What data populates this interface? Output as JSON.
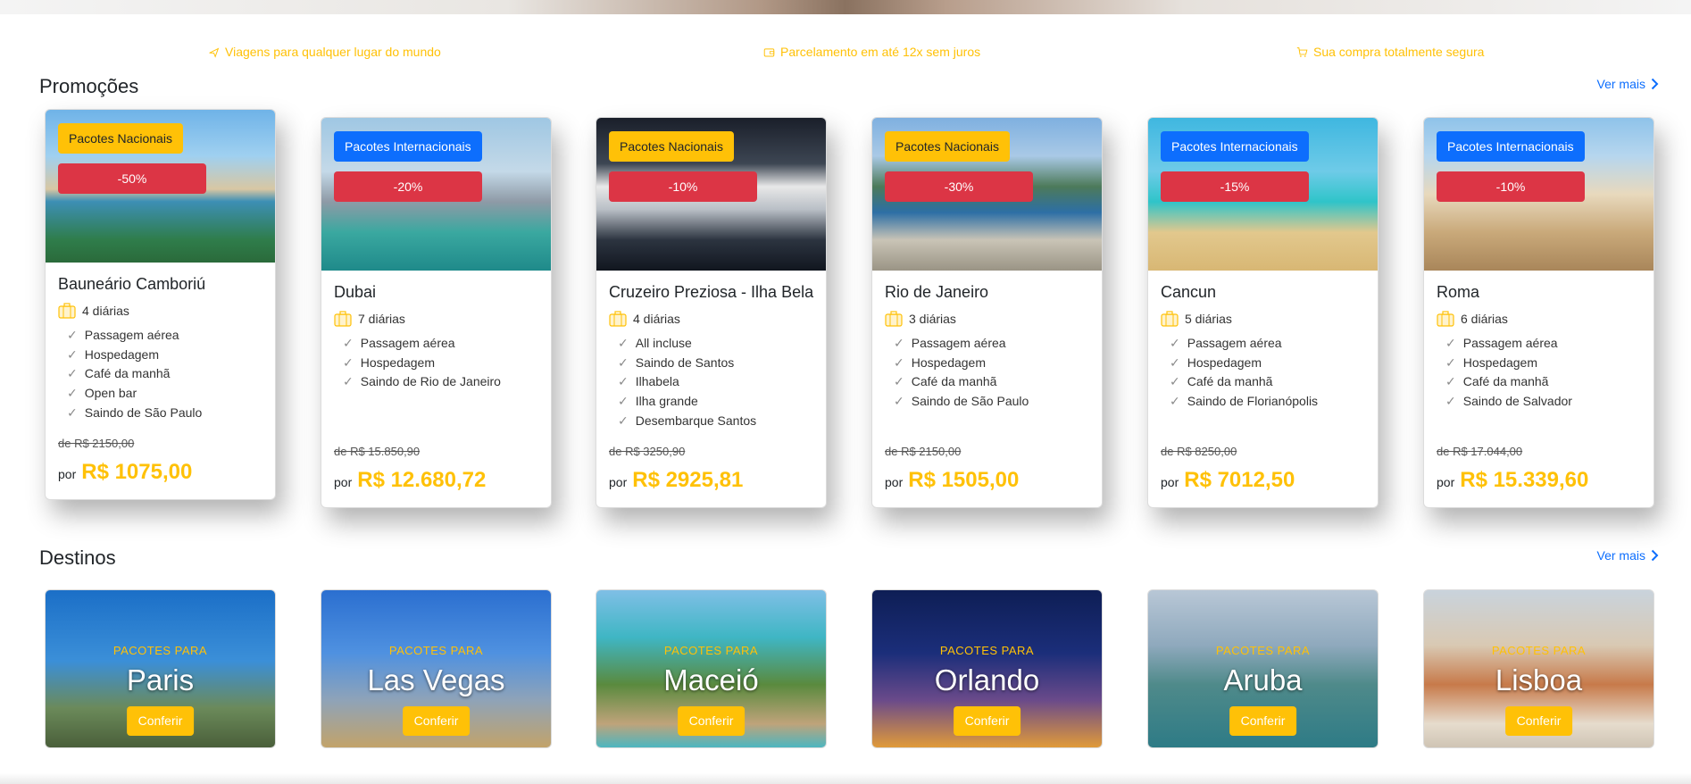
{
  "features": [
    {
      "icon": "plane-icon",
      "text": "Viagens para qualquer lugar do mundo"
    },
    {
      "icon": "wallet-icon",
      "text": "Parcelamento em até 12x sem juros"
    },
    {
      "icon": "secure-cart-icon",
      "text": "Sua compra totalmente segura"
    }
  ],
  "promocoes": {
    "title": "Promoções",
    "ver_mais": "Ver mais",
    "cards": [
      {
        "type": "Pacotes Nacionais",
        "discount": "-50%",
        "name": "Bauneário Camboriú",
        "days": "4 diárias",
        "items": [
          "Passagem aérea",
          "Hospedagem",
          "Café da manhã",
          "Open bar",
          "Saindo de São Paulo"
        ],
        "old_price": "de R$ 2150,00",
        "por": "por",
        "price": "R$ 1075,00"
      },
      {
        "type": "Pacotes Internacionais",
        "discount": "-20%",
        "name": "Dubai",
        "days": "7 diárias",
        "items": [
          "Passagem aérea",
          "Hospedagem",
          "Saindo de Rio de Janeiro"
        ],
        "old_price": "de R$ 15.850,90",
        "por": "por",
        "price": "R$ 12.680,72"
      },
      {
        "type": "Pacotes Nacionais",
        "discount": "-10%",
        "name": "Cruzeiro Preziosa - Ilha Bela",
        "days": "4 diárias",
        "items": [
          "All incluse",
          "Saindo de Santos",
          "Ilhabela",
          "Ilha grande",
          "Desembarque Santos"
        ],
        "old_price": "de R$ 3250,90",
        "por": "por",
        "price": "R$ 2925,81"
      },
      {
        "type": "Pacotes Nacionais",
        "discount": "-30%",
        "name": "Rio de Janeiro",
        "days": "3 diárias",
        "items": [
          "Passagem aérea",
          "Hospedagem",
          "Café da manhã",
          "Saindo de São Paulo"
        ],
        "old_price": "de R$ 2150,00",
        "por": "por",
        "price": "R$ 1505,00"
      },
      {
        "type": "Pacotes Internacionais",
        "discount": "-15%",
        "name": "Cancun",
        "days": "5 diárias",
        "items": [
          "Passagem aérea",
          "Hospedagem",
          "Café da manhã",
          "Saindo de Florianópolis"
        ],
        "old_price": "de R$ 8250,00",
        "por": "por",
        "price": "R$ 7012,50"
      },
      {
        "type": "Pacotes Internacionais",
        "discount": "-10%",
        "name": "Roma",
        "days": "6 diárias",
        "items": [
          "Passagem aérea",
          "Hospedagem",
          "Café da manhã",
          "Saindo de Salvador"
        ],
        "old_price": "de R$ 17.044,00",
        "por": "por",
        "price": "R$ 15.339,60"
      }
    ]
  },
  "destinos": {
    "title": "Destinos",
    "ver_mais": "Ver mais",
    "subtitle": "PACOTES PARA",
    "button": "Conferir",
    "items": [
      {
        "name": "Paris"
      },
      {
        "name": "Las Vegas"
      },
      {
        "name": "Maceió"
      },
      {
        "name": "Orlando"
      },
      {
        "name": "Aruba"
      },
      {
        "name": "Lisboa"
      }
    ]
  },
  "colors": {
    "accent": "#ffc107",
    "primary": "#0d6efd",
    "danger": "#dc3545"
  }
}
